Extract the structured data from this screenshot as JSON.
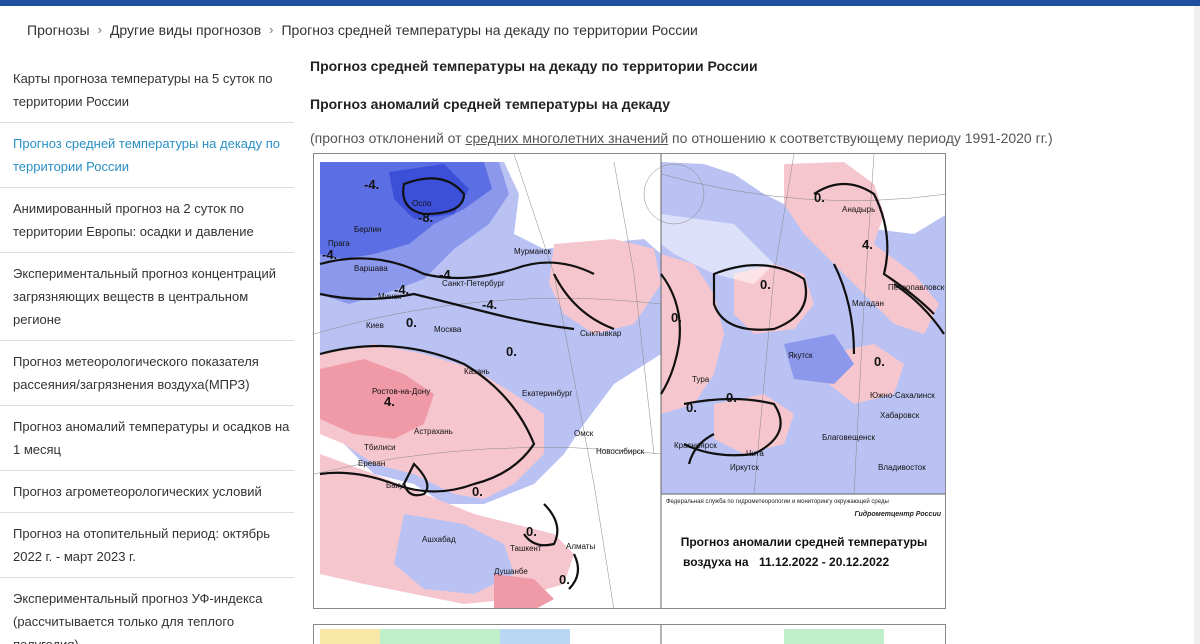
{
  "breadcrumb": {
    "items": [
      "Прогнозы",
      "Другие виды прогнозов",
      "Прогноз средней температуры на декаду по территории России"
    ],
    "separator": "›"
  },
  "sidebar": {
    "items": [
      {
        "label": "Карты прогноза температуры на 5 суток по территории России"
      },
      {
        "label": "Прогноз средней температуры на декаду по территории России",
        "active": true
      },
      {
        "label": "Анимированный прогноз на 2 суток по территории Европы: осадки и давление"
      },
      {
        "label": "Экспериментальный прогноз концентраций загрязняющих веществ в центральном регионе"
      },
      {
        "label": "Прогноз метеорологического показателя рассеяния/загрязнения воздуха(МПРЗ)"
      },
      {
        "label": "Прогноз аномалий температуры и осадков на 1 месяц"
      },
      {
        "label": "Прогноз агрометеорологических условий"
      },
      {
        "label": "Прогноз на отопительный период: октябрь 2022 г. - март 2023 г."
      },
      {
        "label": "Экспериментальный прогноз УФ-индекса (рассчитывается только для теплого полугодия)"
      }
    ]
  },
  "main": {
    "title": "Прогноз средней температуры на декаду по территории России",
    "subtitle": "Прогноз аномалий средней температуры на декаду",
    "note_before": "(прогноз отклонений от ",
    "note_link": "средних многолетних значений",
    "note_after": " по отношению к соответствующему периоду 1991-2020 гг.)"
  },
  "map": {
    "agency": "Федеральная служба по гидрометеорологии и мониторингу окружающей среды",
    "center": "Гидрометцентр России",
    "caption_line1": "Прогноз аномалии средней температуры",
    "caption_line2_prefix": "воздуха на",
    "caption_dates": "11.12.2022 - 20.12.2022",
    "colors": {
      "cold_strong": "#3b4fd8",
      "cold": "#8b98ec",
      "cold_light": "#b9c2f3",
      "warm_light": "#f6c6cf",
      "warm": "#f09aa8",
      "contour": "#111111"
    },
    "cities_left": [
      "Осло",
      "Берлин",
      "Прага",
      "Варшава",
      "Минск",
      "Киев",
      "Москва",
      "Санкт-Петербург",
      "Мурманск",
      "Сыктывкар",
      "Казань",
      "Ростов-на-Дону",
      "Астрахань",
      "Тбилиси",
      "Ереван",
      "Баку",
      "Екатеринбург",
      "Омск",
      "Новосибирск",
      "Ашхабад",
      "Ташкент",
      "Алматы",
      "Душанбе"
    ],
    "cities_right": [
      "Анадырь",
      "Петропавловск-Камчатский",
      "Магадан",
      "Якутск",
      "Тура",
      "Южно-Сахалинск",
      "Хабаровск",
      "Благовещенск",
      "Красноярск",
      "Чита",
      "Иркутск",
      "Владивосток"
    ],
    "contour_labels": [
      "-4.",
      "-8.",
      "-4.",
      "-4.",
      "-4.",
      "-4.",
      "0.",
      "0.",
      "0.",
      "4.",
      "0.",
      "0.",
      "0.",
      "0.",
      "0.",
      "4.",
      "0.",
      "0.",
      "0."
    ]
  }
}
